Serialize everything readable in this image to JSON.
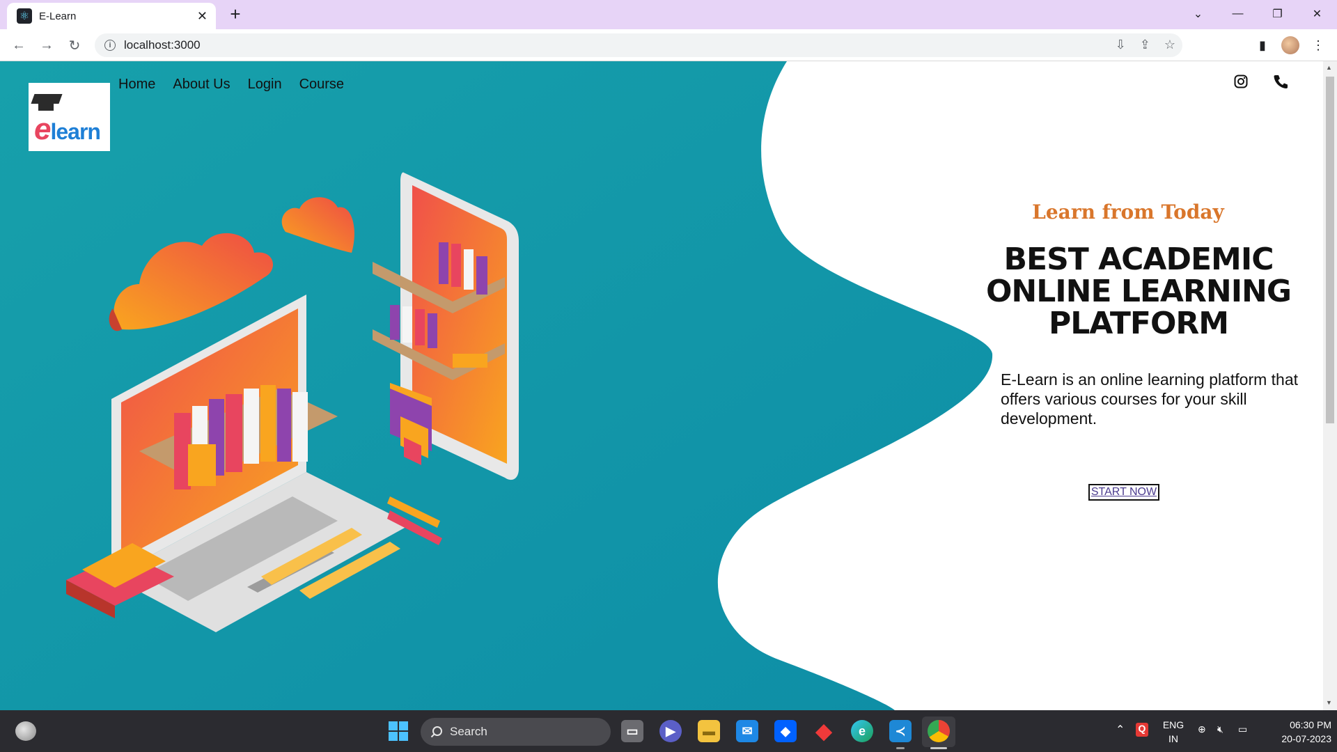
{
  "browser": {
    "tab_title": "E-Learn",
    "url": "localhost:3000"
  },
  "site": {
    "logo_letter": "e",
    "logo_rest": "learn",
    "nav": [
      {
        "label": "Home"
      },
      {
        "label": "About Us"
      },
      {
        "label": "Login"
      },
      {
        "label": "Course"
      }
    ],
    "hero": {
      "tagline": "Learn from Today",
      "headline": "BEST ACADEMIC ONLINE LEARNING PLATFORM",
      "description": "E-Learn is an online learning platform that offers various courses for your skill development.",
      "cta": "START NOW"
    },
    "colors": {
      "teal": "#16a6ad",
      "tagline": "#d9762b",
      "accent_orange": "#f5a623",
      "accent_red": "#e8455f"
    }
  },
  "taskbar": {
    "search_label": "Search",
    "language_line1": "ENG",
    "language_line2": "IN",
    "time": "06:30 PM",
    "date": "20-07-2023",
    "apps": [
      "file-explorer-icon",
      "teams-icon",
      "folder-icon",
      "mail-icon",
      "dropbox-icon",
      "app-red-diamond-icon",
      "edge-icon",
      "vscode-icon",
      "chrome-icon"
    ]
  }
}
